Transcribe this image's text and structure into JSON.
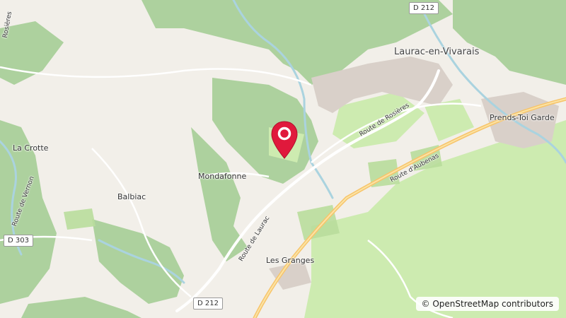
{
  "map": {
    "places": {
      "laurac": "Laurac-en-Vivarais",
      "prends_toi_garde": "Prends-Toi Garde",
      "la_crotte": "La Crotte",
      "mondafonne": "Mondafonne",
      "balbiac": "Balbiac",
      "les_granges": "Les Granges"
    },
    "roads": {
      "d212_top": "D 212",
      "d212_bottom": "D 212",
      "d303": "D 303",
      "route_rosieres": "Route de Rosières",
      "route_aubenas": "Route d'Aubenas",
      "route_laurac": "Route de Laurac",
      "route_vernon": "Route de Vernon",
      "rosieres_edge": "Rosières"
    },
    "attribution": "© OpenStreetMap contributors",
    "marker": {
      "color": "#e0193c"
    }
  }
}
